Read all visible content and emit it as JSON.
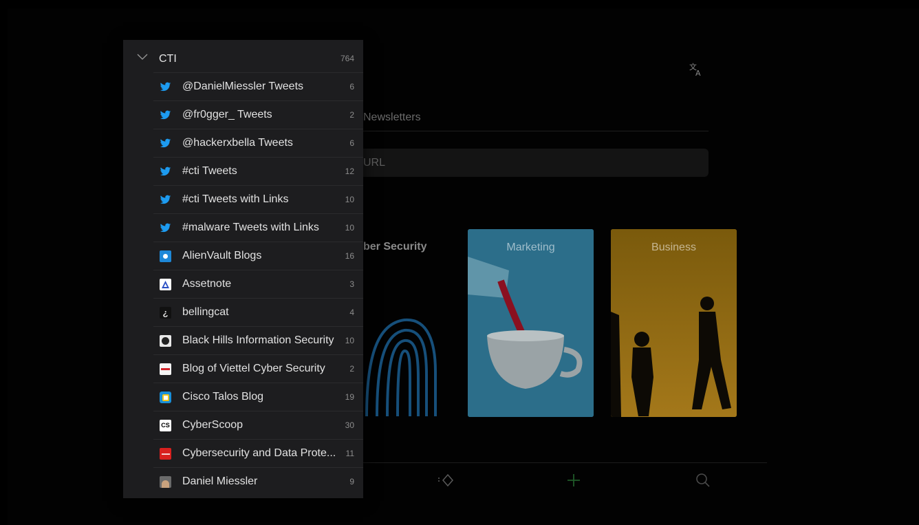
{
  "background": {
    "tab_label": "Newsletters",
    "url_placeholder": "URL",
    "category_partial": "ber Security",
    "cards": [
      {
        "label": "Marketing"
      },
      {
        "label": "Business"
      }
    ],
    "icons": [
      "translate-icon",
      "tags-icon",
      "plus-icon",
      "search-icon"
    ]
  },
  "panel": {
    "title": "CTI",
    "count": "764",
    "items": [
      {
        "label": "@DanielMiessler Tweets",
        "count": "6",
        "icon": "twitter-icon"
      },
      {
        "label": "@fr0gger_ Tweets",
        "count": "2",
        "icon": "twitter-icon"
      },
      {
        "label": "@hackerxbella Tweets",
        "count": "6",
        "icon": "twitter-icon"
      },
      {
        "label": "#cti Tweets",
        "count": "12",
        "icon": "twitter-icon"
      },
      {
        "label": "#cti Tweets with Links",
        "count": "10",
        "icon": "twitter-icon"
      },
      {
        "label": "#malware Tweets with Links",
        "count": "10",
        "icon": "twitter-icon"
      },
      {
        "label": "AlienVault Blogs",
        "count": "16",
        "icon": "alienvault-icon"
      },
      {
        "label": "Assetnote",
        "count": "3",
        "icon": "assetnote-icon"
      },
      {
        "label": "bellingcat",
        "count": "4",
        "icon": "bellingcat-icon"
      },
      {
        "label": "Black Hills Information Security",
        "count": "10",
        "icon": "bhis-icon"
      },
      {
        "label": "Blog of Viettel Cyber Security",
        "count": "2",
        "icon": "viettel-icon"
      },
      {
        "label": "Cisco Talos Blog",
        "count": "19",
        "icon": "talos-icon"
      },
      {
        "label": "CyberScoop",
        "count": "30",
        "icon": "cyberscoop-icon"
      },
      {
        "label": "Cybersecurity and Data Prote...",
        "count": "11",
        "icon": "politico-icon"
      },
      {
        "label": "Daniel Miessler",
        "count": "9",
        "icon": "avatar-icon"
      }
    ]
  },
  "colors": {
    "twitter": "#1d9bf0",
    "panel_bg": "#1d1d1f",
    "accent_green": "#2d8a3e"
  }
}
